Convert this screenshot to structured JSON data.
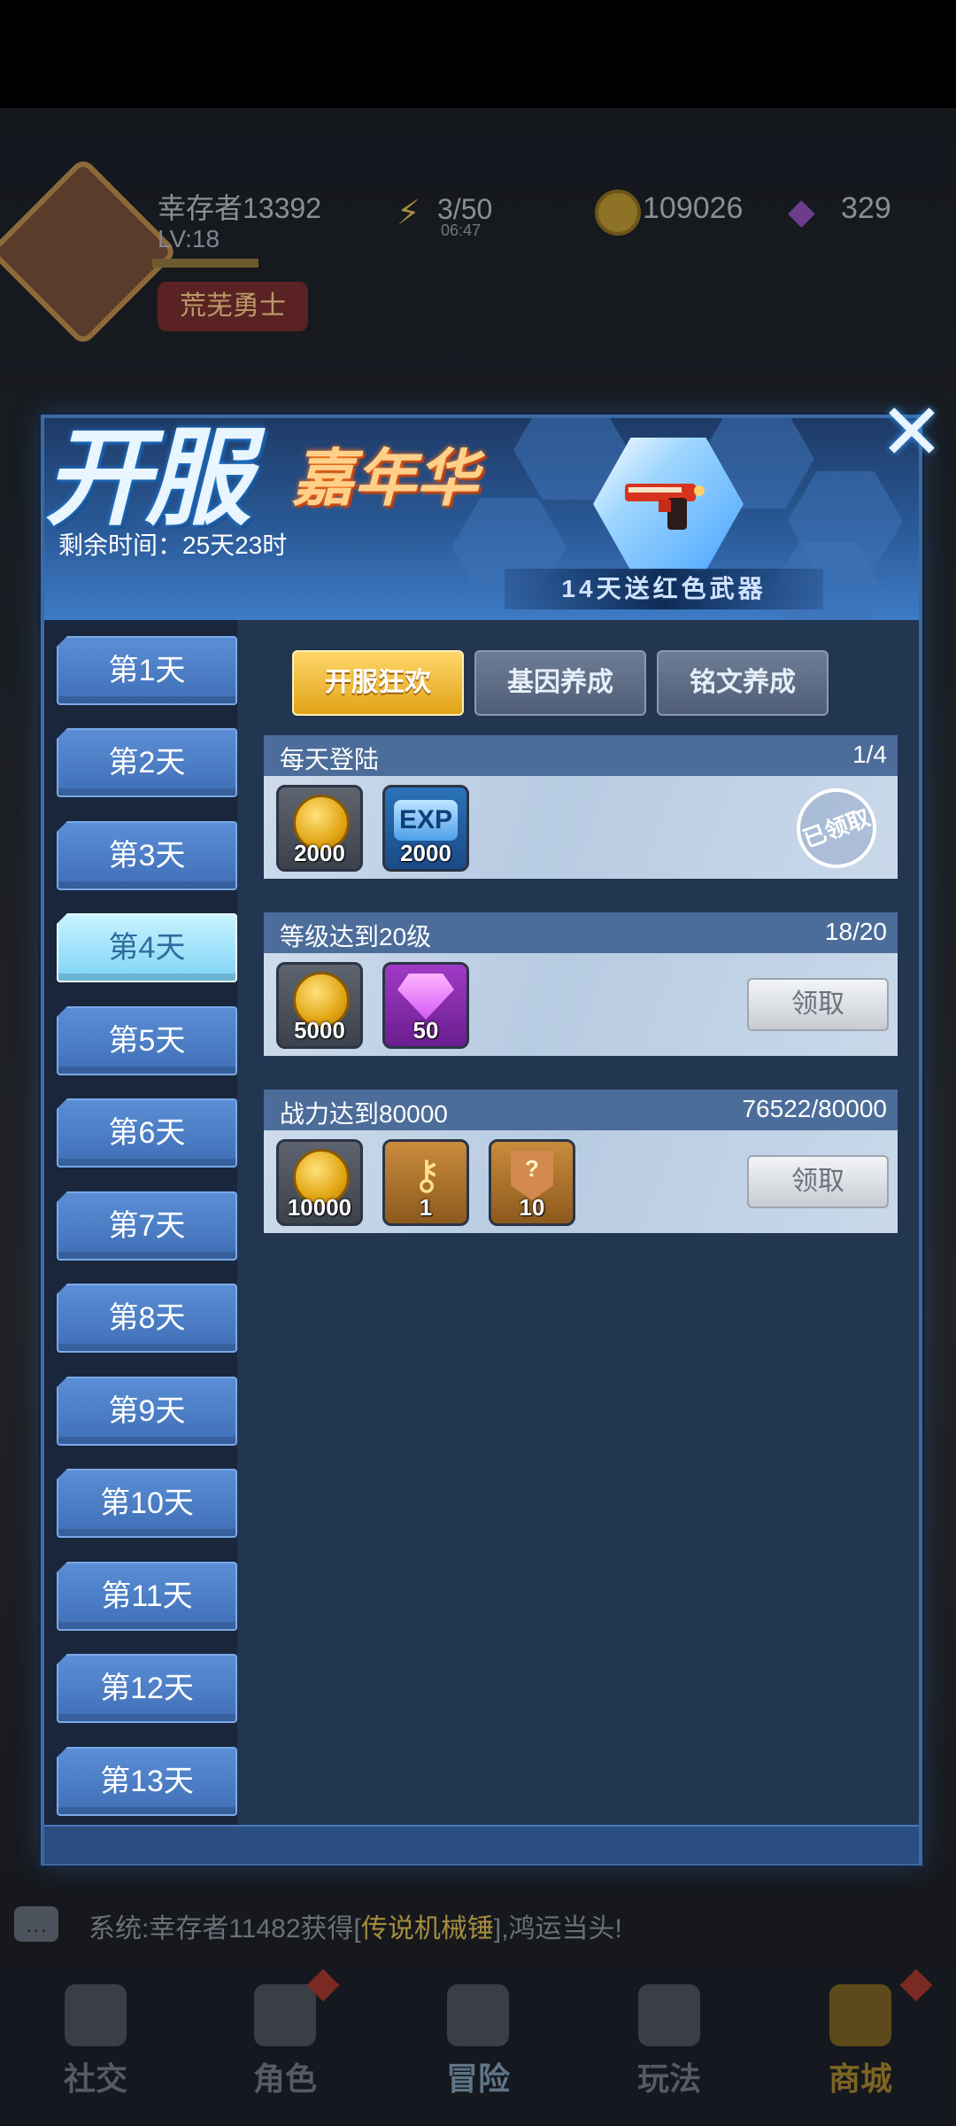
{
  "hud": {
    "player_name": "幸存者13392",
    "level": "LV:18",
    "title_badge": "荒芜勇士",
    "energy": "3/50",
    "energy_timer": "06:47",
    "coins": "109026",
    "gems": "329"
  },
  "chat": {
    "prefix": "系统:幸存者11482获得[",
    "item": "传说机械锤",
    "suffix": "],鸿运当头!"
  },
  "bottom_nav": [
    {
      "label": "社交",
      "icon": "social-icon"
    },
    {
      "label": "角色",
      "icon": "character-icon"
    },
    {
      "label": "冒险",
      "icon": "adventure-map-icon"
    },
    {
      "label": "玩法",
      "icon": "gamepad-icon"
    },
    {
      "label": "商城",
      "icon": "shop-cart-icon"
    }
  ],
  "panel": {
    "title_main": "开服",
    "title_sub": "嘉年华",
    "remaining_time": "剩余时间：25天23时",
    "weapon_banner": "14天送红色武器",
    "close_icon": "close-x-icon",
    "days": [
      "第1天",
      "第2天",
      "第3天",
      "第4天",
      "第5天",
      "第6天",
      "第7天",
      "第8天",
      "第9天",
      "第10天",
      "第11天",
      "第12天",
      "第13天"
    ],
    "active_day": "第4天",
    "tabs": [
      "开服狂欢",
      "基因养成",
      "铭文养成"
    ],
    "active_tab": "开服狂欢",
    "tasks": [
      {
        "title": "每天登陆",
        "progress": "1/4",
        "rewards": [
          {
            "type": "coin",
            "amount": "2000"
          },
          {
            "type": "exp",
            "label": "EXP",
            "amount": "2000"
          }
        ],
        "status": "已领取"
      },
      {
        "title": "等级达到20级",
        "progress": "18/20",
        "rewards": [
          {
            "type": "coin",
            "amount": "5000"
          },
          {
            "type": "gem",
            "amount": "50"
          }
        ],
        "button": "领取"
      },
      {
        "title": "战力达到80000",
        "progress": "76522/80000",
        "rewards": [
          {
            "type": "coin",
            "amount": "10000"
          },
          {
            "type": "key",
            "amount": "1"
          },
          {
            "type": "badge",
            "amount": "10"
          }
        ],
        "button": "领取"
      }
    ]
  },
  "colors": {
    "panel_bg": "#213049",
    "accent_gold": "#e1a318",
    "day_active": "#7ed3f6",
    "day_inactive": "#3f6fb6"
  }
}
